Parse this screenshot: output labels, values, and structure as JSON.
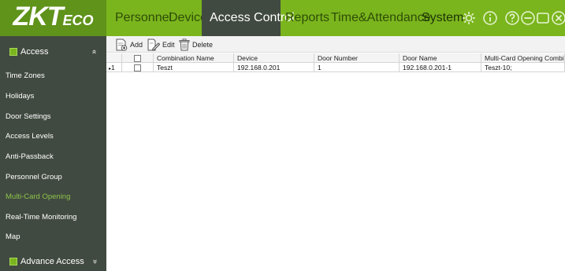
{
  "brand": {
    "logo_main": "ZKT",
    "logo_sub": "ECO"
  },
  "nav": {
    "items": [
      {
        "label": "Personnel"
      },
      {
        "label": "Device"
      },
      {
        "label": "Access Control",
        "active": true
      },
      {
        "label": "Reports"
      },
      {
        "label": "Time&Attendance"
      },
      {
        "label": "System"
      }
    ],
    "icons": [
      "gear-icon",
      "info-icon",
      "help-icon",
      "minimize-icon",
      "maximize-icon",
      "close-icon"
    ]
  },
  "sidebar": {
    "section_title": "Access",
    "section_chevron": "»",
    "items": [
      {
        "label": "Time Zones"
      },
      {
        "label": "Holidays"
      },
      {
        "label": "Door Settings"
      },
      {
        "label": "Access Levels"
      },
      {
        "label": "Anti-Passback"
      },
      {
        "label": "Personnel Group"
      },
      {
        "label": "Multi-Card Opening",
        "active": true
      },
      {
        "label": "Real-Time Monitoring"
      },
      {
        "label": "Map"
      }
    ],
    "footer_title": "Advance Access",
    "footer_chevron": "»"
  },
  "toolbar": {
    "add_label": "Add",
    "edit_label": "Edit",
    "delete_label": "Delete"
  },
  "table": {
    "columns": [
      "Combination Name",
      "Device",
      "Door Number",
      "Door Name",
      "Multi-Card Opening Combi..."
    ],
    "rows": [
      {
        "num": "1",
        "cells": [
          "Teszt",
          "192.168.0.201",
          "1",
          "192.168.0.201-1",
          "Teszt-10;"
        ]
      }
    ]
  },
  "colors": {
    "topbar": "#7ab51d",
    "logo_bg": "#5f931a",
    "sidebar": "#414a40",
    "active_nav": "#414a40",
    "active_side_text": "#8bc34a"
  }
}
